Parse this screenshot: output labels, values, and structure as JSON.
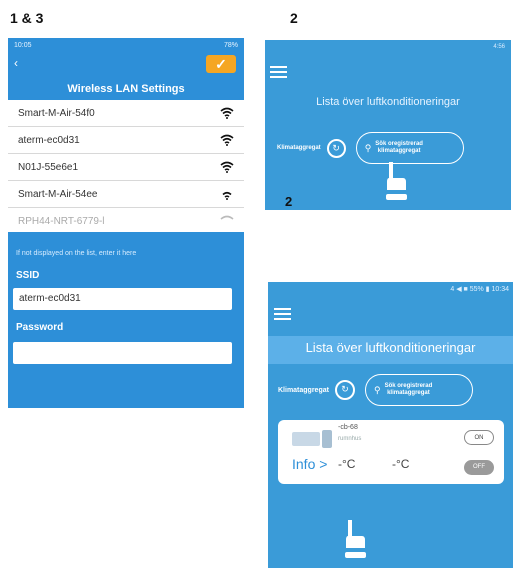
{
  "labels": {
    "top_left": "1 & 3",
    "top_right": "2",
    "middle": "2"
  },
  "phone1": {
    "status_left": "10:05",
    "status_right": "78%",
    "title": "Wireless LAN Settings",
    "networks": [
      "Smart-M-Air-54f0",
      "aterm-ec0d31",
      "N01J-55e6e1",
      "Smart-M-Air-54ee",
      "RPH44-NRT-6779-l"
    ],
    "hint": "If not displayed on the list, enter it here",
    "ssid_label": "SSID",
    "ssid_value": "aterm-ec0d31",
    "password_label": "Password",
    "password_value": ""
  },
  "phone2": {
    "status": "4:56",
    "title": "Lista över luftkonditioneringar",
    "klim_label": "Klimataggregat",
    "search_line1": "Sök oregistrerad",
    "search_line2": "klimataggregat"
  },
  "phone3": {
    "status": "4 ◀ ■ 55% ▮ 10:34",
    "title": "Lista över luftkonditioneringar",
    "klim_label": "Klimataggregat",
    "search_line1": "Sök oregistrerad",
    "search_line2": "klimataggregat",
    "device_name": "-cb-68",
    "device_room": "rumnhus",
    "info_label": "Info >",
    "temp_indoor": "-°C",
    "temp_outdoor": "-°C",
    "on_label": "ON",
    "off_label": "OFF"
  },
  "colors": {
    "app_blue": "#3a9bd8",
    "accent_orange": "#f5a623"
  }
}
